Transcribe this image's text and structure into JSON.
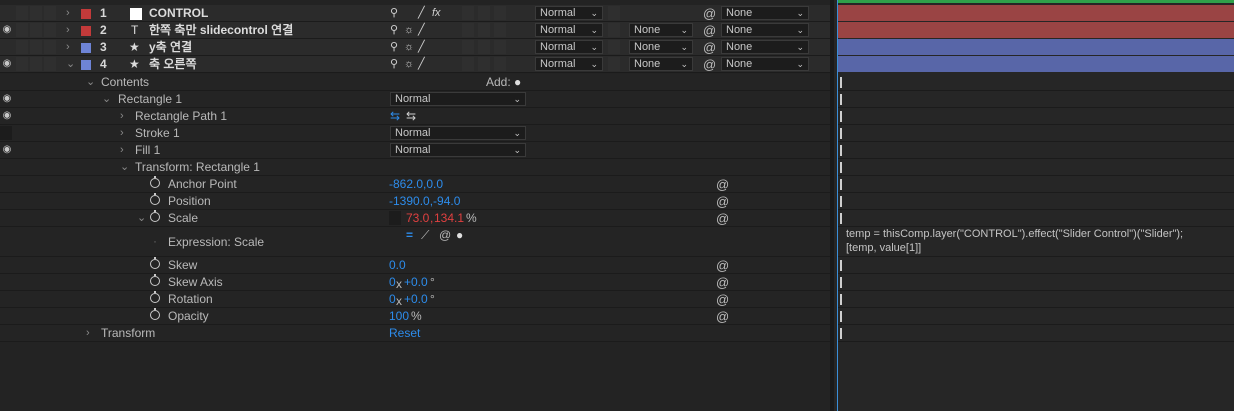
{
  "colors": {
    "red_label": "#b13b3b",
    "blue_label": "#6e84d6",
    "value_blue": "#2d8ceb",
    "value_red": "#e04040",
    "green_top": "#2fa14a"
  },
  "layers": [
    {
      "num": "1",
      "name": "CONTROL",
      "type_icon": "□",
      "color": "#ffffff",
      "mode": "Normal",
      "trkmat": "",
      "parent": "None"
    },
    {
      "num": "2",
      "name": "한쪽 축만 slidecontrol 연결",
      "type_icon": "T",
      "color": "#c23a3a",
      "mode": "Normal",
      "trkmat": "None",
      "parent": "None"
    },
    {
      "num": "3",
      "name": "y축 연결",
      "type_icon": "★",
      "color": "#6e84d6",
      "mode": "Normal",
      "trkmat": "None",
      "parent": "None"
    },
    {
      "num": "4",
      "name": "축 오른쪽",
      "type_icon": "★",
      "color": "#6e84d6",
      "mode": "Normal",
      "trkmat": "None",
      "parent": "None"
    }
  ],
  "contents": {
    "label": "Contents",
    "add_label": "Add:"
  },
  "rect": {
    "label": "Rectangle 1",
    "mode": "Normal"
  },
  "rect_path": {
    "label": "Rectangle Path 1"
  },
  "stroke": {
    "label": "Stroke 1",
    "mode": "Normal"
  },
  "fill": {
    "label": "Fill 1",
    "mode": "Normal"
  },
  "transform_rect": {
    "label": "Transform: Rectangle 1"
  },
  "props": {
    "anchor": {
      "label": "Anchor Point",
      "value": "-862.0,0.0"
    },
    "position": {
      "label": "Position",
      "value": "-1390.0,-94.0"
    },
    "scale": {
      "label": "Scale",
      "v1": "73.0",
      "v2": "134.1",
      "unit": "%"
    },
    "expression": {
      "label": "Expression: Scale",
      "code": "temp = thisComp.layer(\"CONTROL\").effect(\"Slider Control\")(\"Slider\");\n[temp, value[1]]"
    },
    "skew": {
      "label": "Skew",
      "value": "0.0"
    },
    "skew_axis": {
      "label": "Skew Axis",
      "value1": "0",
      "x": "x",
      "value2": "+0.0",
      "deg": "°"
    },
    "rotation": {
      "label": "Rotation",
      "value1": "0",
      "x": "x",
      "value2": "+0.0",
      "deg": "°"
    },
    "opacity": {
      "label": "Opacity",
      "value": "100",
      "unit": "%"
    }
  },
  "transform": {
    "label": "Transform",
    "reset": "Reset"
  },
  "icons": {
    "fx": "fx",
    "eye": "eye-icon",
    "spiral": "spiral-icon",
    "stopwatch": "stopwatch-icon",
    "chevron": "chevron-icon"
  }
}
